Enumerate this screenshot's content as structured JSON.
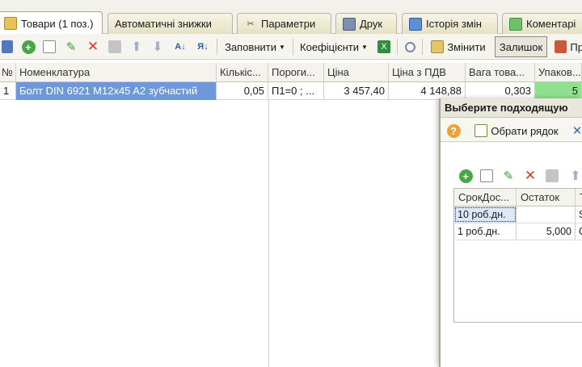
{
  "tabs": [
    {
      "label": "Товари (1 поз.)",
      "icon": "table-icon"
    },
    {
      "label": "Автоматичні знижки",
      "icon": ""
    },
    {
      "label": "Параметри",
      "icon": "tools-icon"
    },
    {
      "label": "Друк",
      "icon": "printer-icon"
    },
    {
      "label": "Історія змін",
      "icon": "history-icon"
    },
    {
      "label": "Коментарі",
      "icon": "comment-icon"
    }
  ],
  "toolbar": {
    "fill_label": "Заповнити",
    "coef_label": "Коефіцієнти",
    "change_label": "Змінити",
    "balance_label": "Залишок",
    "extra_label": "Пр"
  },
  "grid": {
    "columns": [
      "№",
      "Номенклатура",
      "Кількіс...",
      "Пороги...",
      "Ціна",
      "Ціна з ПДВ",
      "Вага това...",
      "Упаков..."
    ],
    "rows": [
      {
        "n": "1",
        "name": "Болт DIN 6921 M12x45 A2 зубчастий",
        "qty": "0,05",
        "thresholds": "П1=0 ; ...",
        "price": "3 457,40",
        "price_vat": "4 148,88",
        "weight": "0,303",
        "pack": "5"
      }
    ]
  },
  "popup": {
    "title": "Выберите подходящую",
    "select_label": "Обрати рядок",
    "columns": [
      "СрокДос...",
      "Остаток",
      "Т"
    ],
    "rows": [
      {
        "term": "10 роб.дн.",
        "stock": "",
        "t": "S"
      },
      {
        "term": "1 роб.дн.",
        "stock": "5,000",
        "t": "C"
      }
    ]
  }
}
